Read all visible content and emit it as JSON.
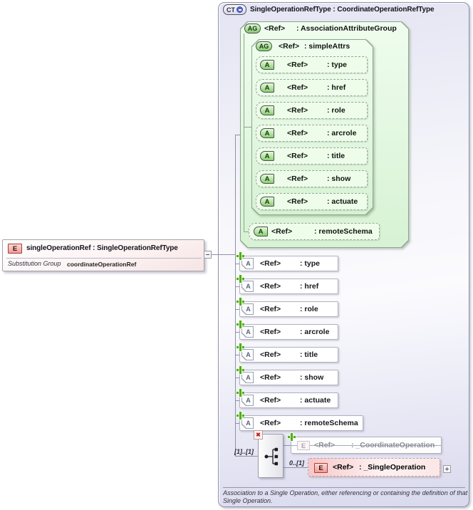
{
  "element": {
    "badge": "E",
    "title": "singleOperationRef : SingleOperationRefType",
    "substitution_group_label": "Substitution Group",
    "substitution_group_value": "coordinateOperationRef"
  },
  "complex_type": {
    "badge": "CT",
    "title": "SingleOperationRefType : CoordinateOperationRefType",
    "annotation": "Association to a Single Operation, either referencing or containing the definition of that Single Operation.",
    "association_attribute_group": {
      "badge": "AG",
      "name": "<Ref>",
      "type": ": AssociationAttributeGroup",
      "simple_attrs": {
        "badge": "AG",
        "name": "<Ref>",
        "type": ": simpleAttrs",
        "attributes": [
          {
            "badge": "A",
            "name": "<Ref>",
            "type": ": type"
          },
          {
            "badge": "A",
            "name": "<Ref>",
            "type": ": href"
          },
          {
            "badge": "A",
            "name": "<Ref>",
            "type": ": role"
          },
          {
            "badge": "A",
            "name": "<Ref>",
            "type": ": arcrole"
          },
          {
            "badge": "A",
            "name": "<Ref>",
            "type": ": title"
          },
          {
            "badge": "A",
            "name": "<Ref>",
            "type": ": show"
          },
          {
            "badge": "A",
            "name": "<Ref>",
            "type": ": actuate"
          }
        ]
      },
      "remote_schema": {
        "badge": "A",
        "name": "<Ref>",
        "type": ": remoteSchema"
      }
    },
    "attributes": [
      {
        "badge": "A",
        "name": "<Ref>",
        "type": ": type"
      },
      {
        "badge": "A",
        "name": "<Ref>",
        "type": ": href"
      },
      {
        "badge": "A",
        "name": "<Ref>",
        "type": ": role"
      },
      {
        "badge": "A",
        "name": "<Ref>",
        "type": ": arcrole"
      },
      {
        "badge": "A",
        "name": "<Ref>",
        "type": ": title"
      },
      {
        "badge": "A",
        "name": "<Ref>",
        "type": ": show"
      },
      {
        "badge": "A",
        "name": "<Ref>",
        "type": ": actuate"
      },
      {
        "badge": "A",
        "name": "<Ref>",
        "type": ": remoteSchema"
      }
    ],
    "content_model": {
      "cardinality": "[1]..[1]",
      "blocked_element": {
        "badge": "E",
        "name": "<Ref>",
        "type": ": _CoordinateOperation"
      },
      "element": {
        "badge": "E",
        "name": "<Ref>",
        "type": ": _SingleOperation",
        "cardinality": "0..[1]"
      }
    }
  },
  "icons": {
    "prohibited": "✖"
  },
  "colors": {
    "green_accent": "#4fae14",
    "group_green": "#e4f8e0",
    "panel_lavender": "#dcdcf0",
    "badge_red_border": "#ad3a3a",
    "blocked_text": "#8c8c96"
  }
}
